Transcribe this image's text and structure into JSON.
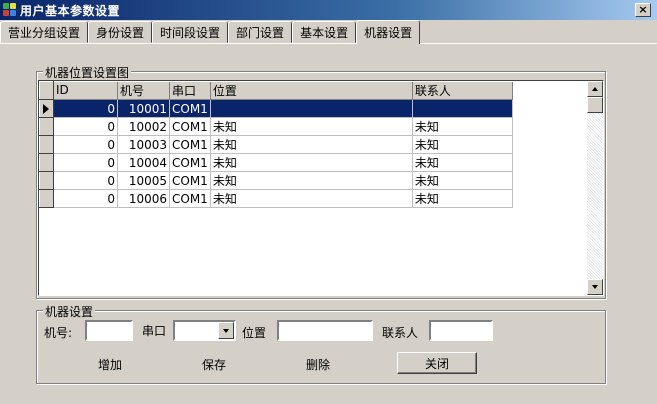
{
  "window": {
    "title": "用户基本参数设置",
    "close_glyph": "×"
  },
  "tabs": [
    {
      "label": "营业分组设置",
      "active": false
    },
    {
      "label": "身份设置",
      "active": false
    },
    {
      "label": "时间段设置",
      "active": false
    },
    {
      "label": "部门设置",
      "active": false
    },
    {
      "label": "基本设置",
      "active": false
    },
    {
      "label": "机器设置",
      "active": true
    }
  ],
  "grid_group": {
    "legend": "机器位置设置图"
  },
  "grid": {
    "columns": [
      "ID",
      "机号",
      "串口",
      "位置",
      "联系人"
    ],
    "rows": [
      {
        "id": "0",
        "machine_no": "10001",
        "port": "COM1",
        "location": "",
        "contact": "",
        "selected": true
      },
      {
        "id": "0",
        "machine_no": "10002",
        "port": "COM1",
        "location": "未知",
        "contact": "未知",
        "selected": false
      },
      {
        "id": "0",
        "machine_no": "10003",
        "port": "COM1",
        "location": "未知",
        "contact": "未知",
        "selected": false
      },
      {
        "id": "0",
        "machine_no": "10004",
        "port": "COM1",
        "location": "未知",
        "contact": "未知",
        "selected": false
      },
      {
        "id": "0",
        "machine_no": "10005",
        "port": "COM1",
        "location": "未知",
        "contact": "未知",
        "selected": false
      },
      {
        "id": "0",
        "machine_no": "10006",
        "port": "COM1",
        "location": "未知",
        "contact": "未知",
        "selected": false
      }
    ]
  },
  "settings": {
    "legend": "机器设置",
    "machine_no_label": "机号:",
    "machine_no_value": "",
    "port_label": "串口",
    "port_value": "",
    "location_label": "位置",
    "location_value": "",
    "contact_label": "联系人",
    "contact_value": ""
  },
  "buttons": {
    "add": "增加",
    "save": "保存",
    "delete": "删除",
    "close": "关闭"
  },
  "colors": {
    "selection": "#0a246a",
    "face": "#d4d0c8",
    "title_start": "#0a246a",
    "title_end": "#a6caf0"
  }
}
